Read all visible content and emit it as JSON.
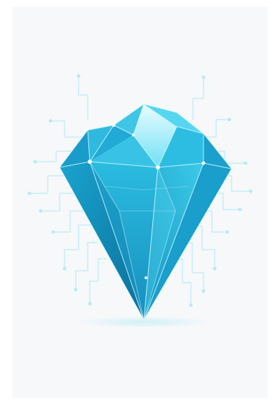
{
  "image": {
    "subject": "diamond-icon",
    "colors": {
      "background": "#ffffff",
      "card": "#f6f8fa",
      "gem_light": "#8fe9f8",
      "gem_mid": "#25bde0",
      "gem_dark": "#0f86b3",
      "gem_deep": "#0a6f9b",
      "edge": "#d7fbff",
      "circuit": "#a9e7f2",
      "shadow": "#cdeef5"
    }
  }
}
